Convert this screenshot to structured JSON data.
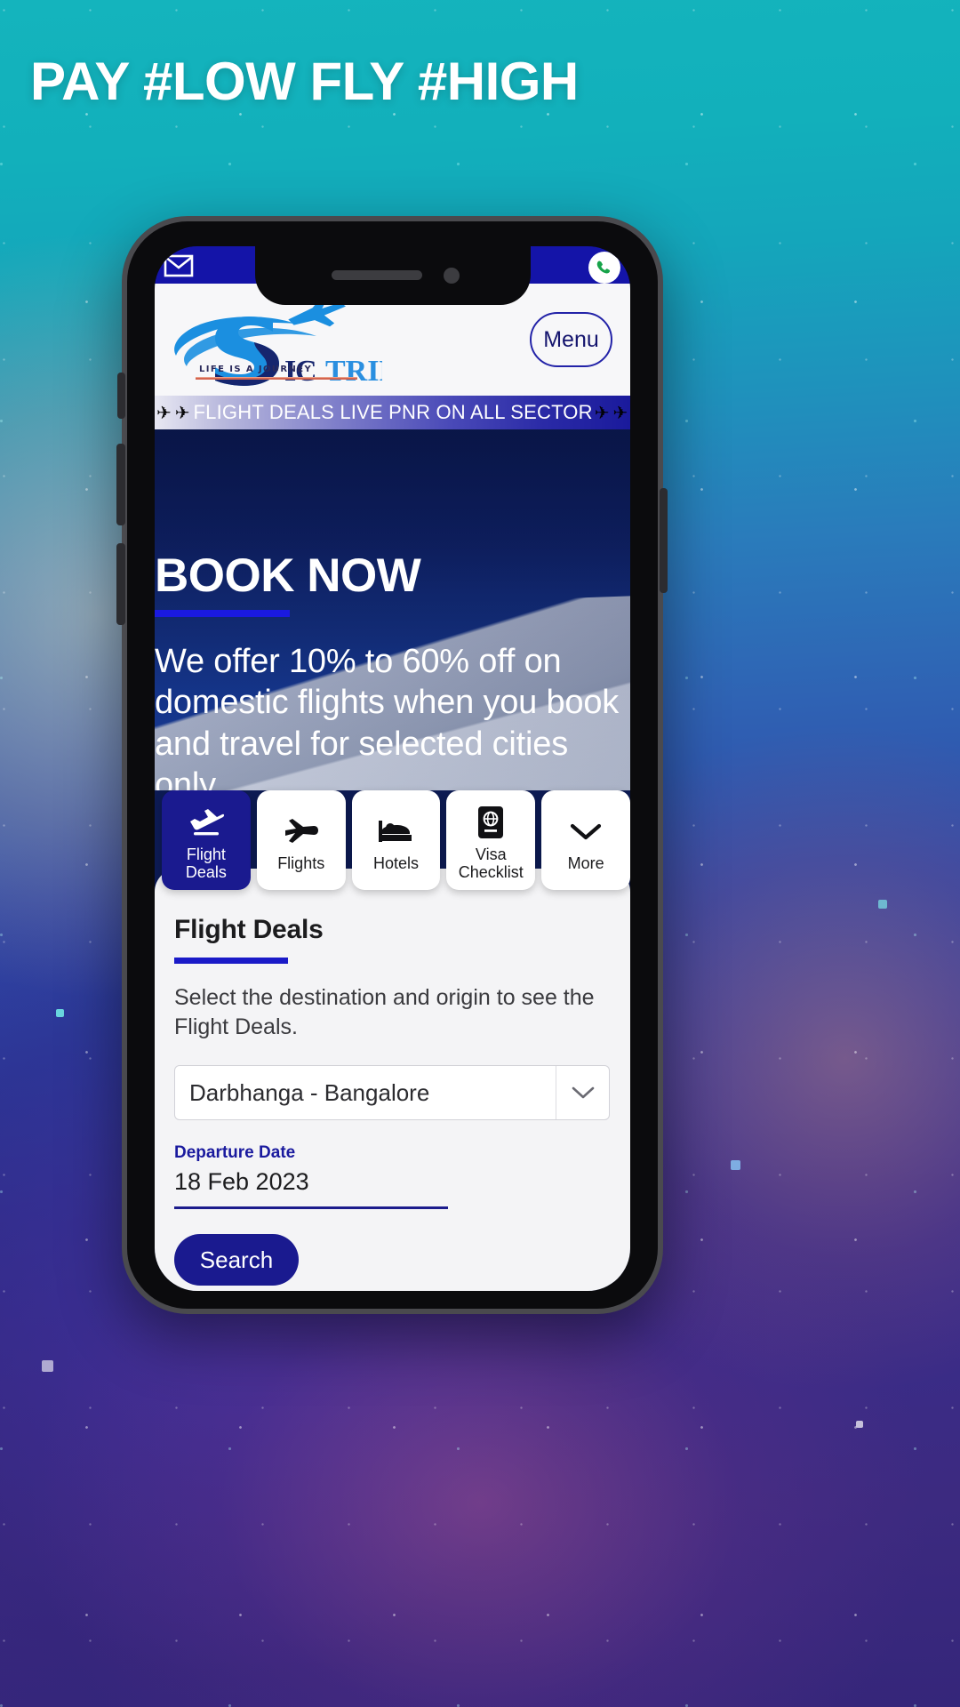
{
  "poster": {
    "headline": "PAY #LOW FLY #HIGH"
  },
  "phone": {
    "status_bar": {
      "mail_icon": "mail-icon",
      "whatsapp_icon": "whatsapp-icon"
    },
    "site_header": {
      "logo_text": "IC TRIP",
      "logo_tagline": "LIFE IS A JOURNEY",
      "menu_label": "Menu"
    },
    "marquee": {
      "text": "FLIGHT DEALS LIVE PNR ON ALL SECTOR",
      "left_plane": "✈",
      "left_plane_2": "✈",
      "right_plane": "✈",
      "right_plane_2": "✈"
    },
    "hero": {
      "title": "BOOK NOW",
      "body": "We offer 10% to 60% off on domestic flights when you book and travel for selected cities only"
    },
    "tabs": [
      {
        "label": "Flight\nDeals",
        "icon": "flight-takeoff-icon",
        "active": true
      },
      {
        "label": "Flights",
        "icon": "airplane-icon",
        "active": false
      },
      {
        "label": "Hotels",
        "icon": "bed-icon",
        "active": false
      },
      {
        "label": "Visa\nChecklist",
        "icon": "passport-globe-icon",
        "active": false
      },
      {
        "label": "More",
        "icon": "chevron-down-icon",
        "active": false
      }
    ],
    "panel": {
      "title": "Flight Deals",
      "subtitle": "Select the destination and origin to see the Flight Deals.",
      "route_select_value": "Darbhanga - Bangalore",
      "departure_label": "Departure Date",
      "departure_value": "18 Feb 2023",
      "search_label": "Search"
    }
  },
  "colors": {
    "brand_navy": "#1a1a8f",
    "brand_blue": "#1a1ae0",
    "logo_blue": "#1b8fe0",
    "logo_navy": "#16256e",
    "tagline_rule": "#d4644f",
    "marquee_end": "#1a1a9c"
  }
}
